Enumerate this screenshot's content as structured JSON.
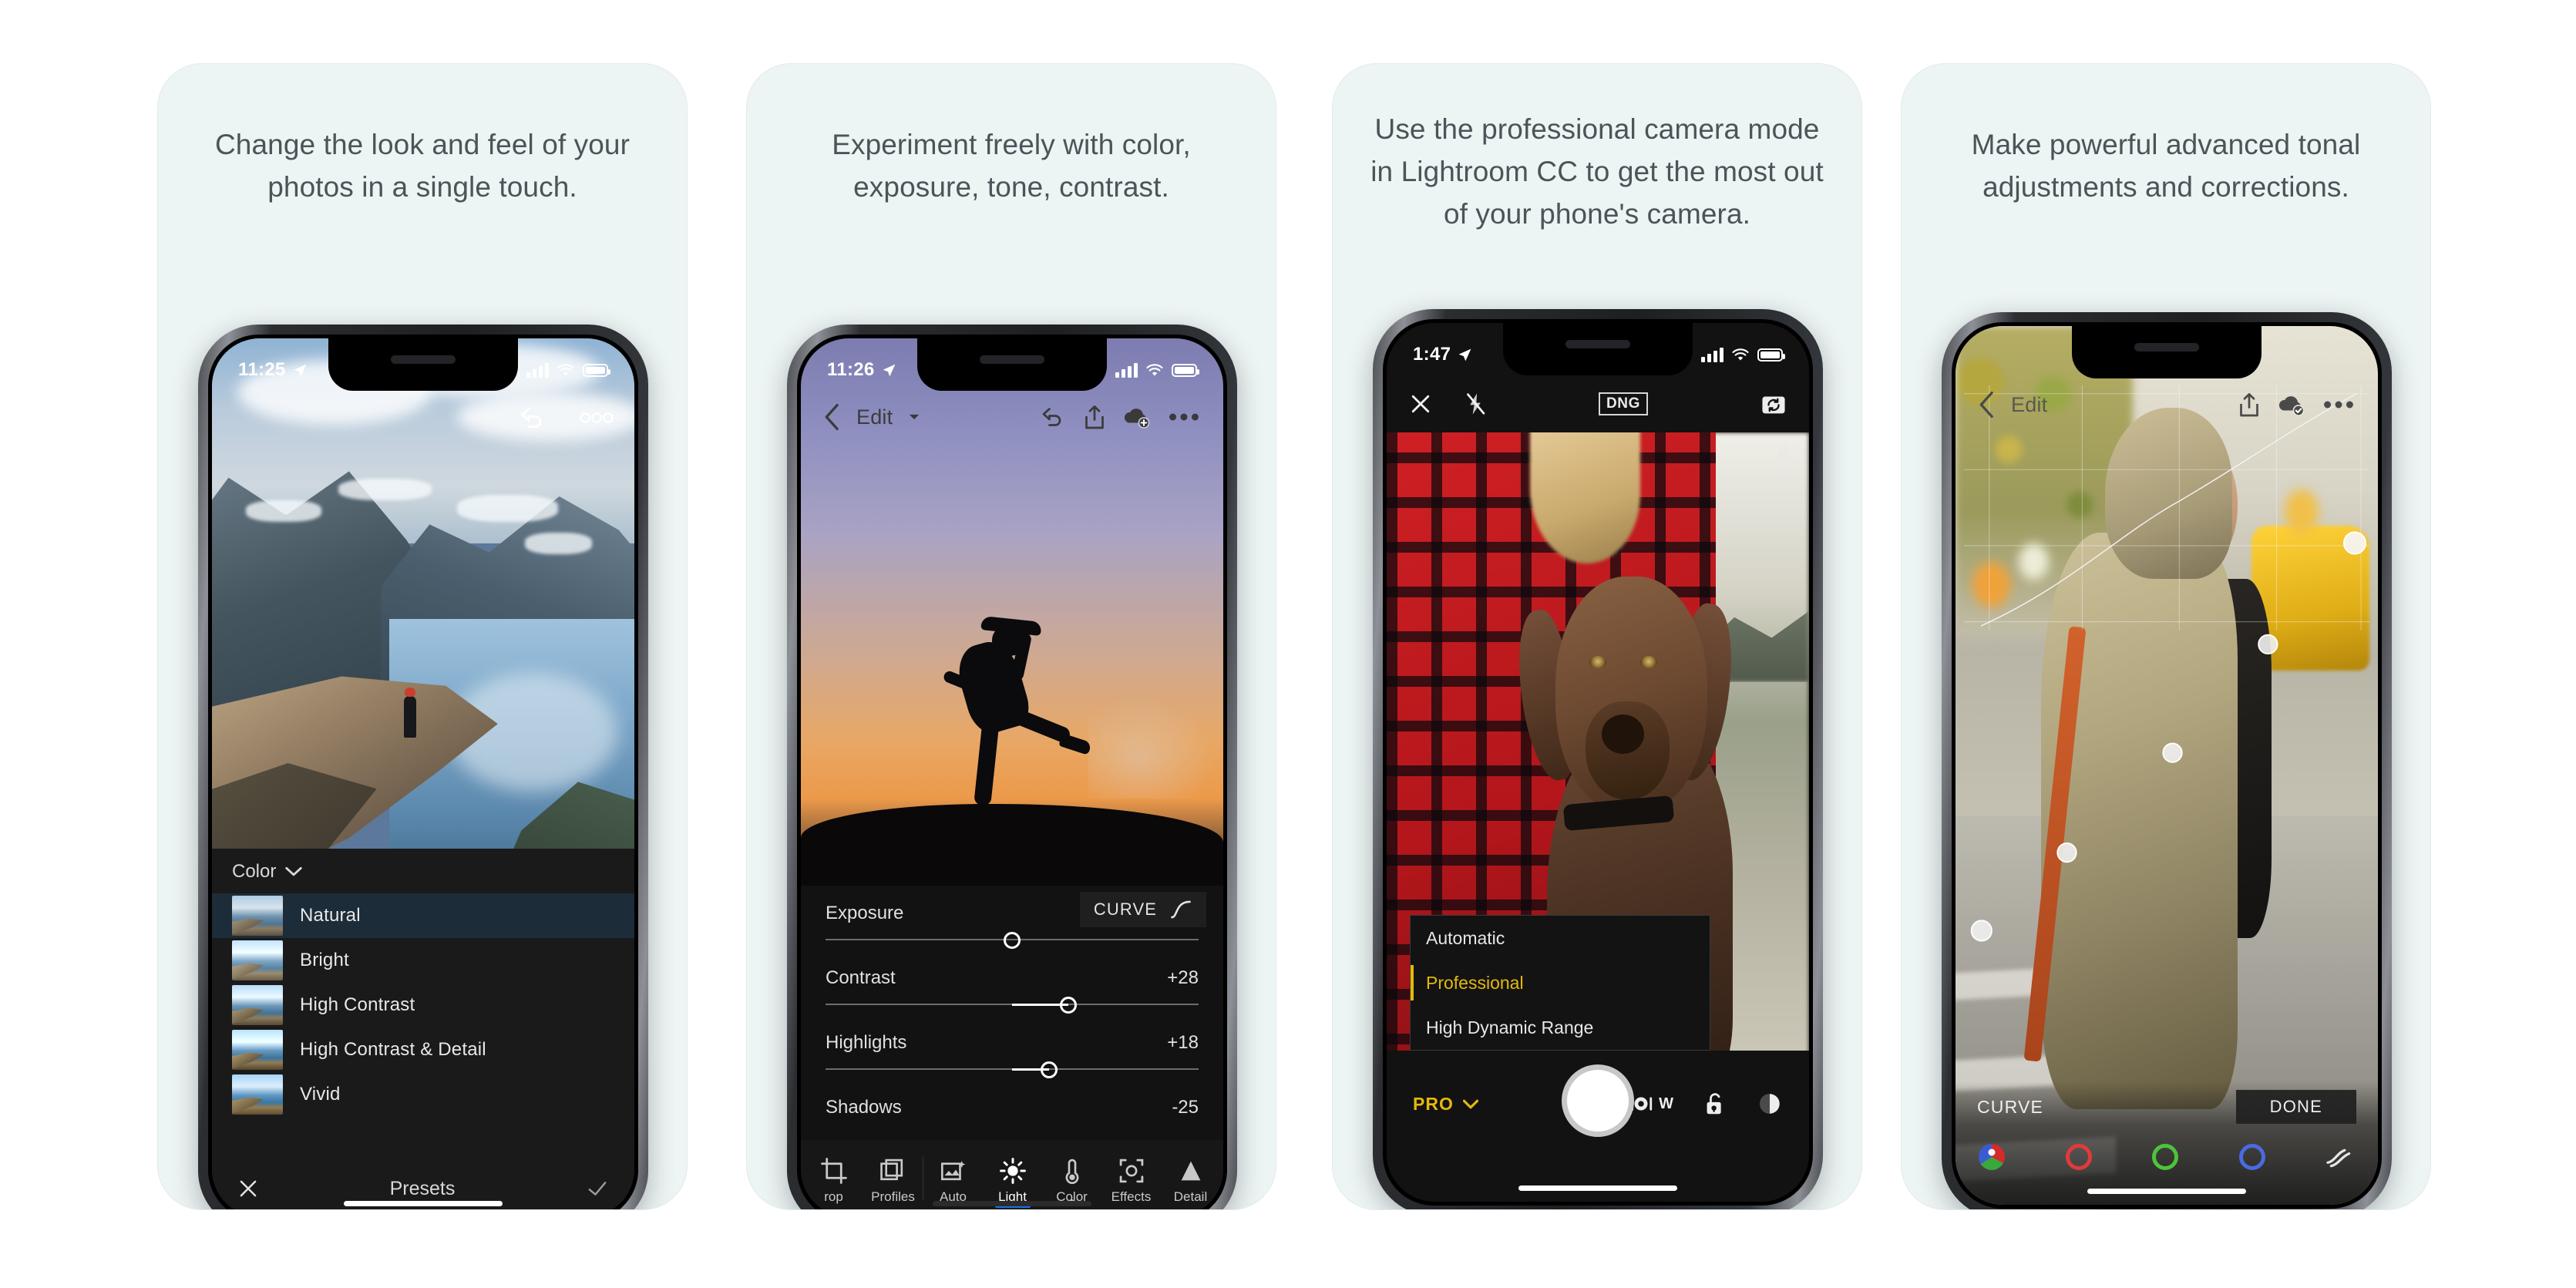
{
  "page": {
    "background": "#ffffff",
    "card_background": "#edf4f4"
  },
  "panels": [
    {
      "caption": "Change the look and feel of your photos in a single touch.",
      "status": {
        "time": "11:25",
        "location_icon": "location-arrow-icon"
      },
      "overlay_icons": [
        "undo-icon",
        "more-options-icon"
      ],
      "section": {
        "label": "Color",
        "chevron": "chevron-down-icon"
      },
      "presets": [
        {
          "label": "Natural",
          "selected": true
        },
        {
          "label": "Bright",
          "selected": false
        },
        {
          "label": "High Contrast",
          "selected": false
        },
        {
          "label": "High Contrast & Detail",
          "selected": false
        },
        {
          "label": "Vivid",
          "selected": false
        }
      ],
      "footer": {
        "close": "close-icon",
        "title": "Presets",
        "confirm": "check-icon"
      }
    },
    {
      "caption": "Experiment freely with color, exposure, tone, contrast.",
      "status": {
        "time": "11:26",
        "location_icon": "location-arrow-icon"
      },
      "nav": {
        "back": "back-chevron-icon",
        "title": "Edit",
        "caret": "caret-down-icon",
        "actions": [
          "undo-icon",
          "share-icon",
          "cloud-add-icon",
          "more-options-icon"
        ]
      },
      "curve_button": {
        "label": "CURVE",
        "icon": "curve-icon"
      },
      "sliders": [
        {
          "name": "Exposure",
          "value": "0.00",
          "pos": 50,
          "fill_from": 50
        },
        {
          "name": "Contrast",
          "value": "+28",
          "pos": 65,
          "fill_from": 50
        },
        {
          "name": "Highlights",
          "value": "+18",
          "pos": 60,
          "fill_from": 50
        },
        {
          "name": "Shadows",
          "value": "-25",
          "pos": 37,
          "fill_from": 50
        }
      ],
      "toolbar": [
        {
          "label": "rop",
          "icon": "crop-icon",
          "active": false
        },
        {
          "label": "Profiles",
          "icon": "profiles-icon",
          "active": false
        },
        {
          "label": "Auto",
          "icon": "auto-icon",
          "active": false
        },
        {
          "label": "Light",
          "icon": "light-icon",
          "active": true
        },
        {
          "label": "Color",
          "icon": "color-icon",
          "active": false,
          "dot": true
        },
        {
          "label": "Effects",
          "icon": "effects-icon",
          "active": false
        },
        {
          "label": "Detail",
          "icon": "detail-icon",
          "active": false
        }
      ]
    },
    {
      "caption": "Use the professional camera mode in Lightroom CC to get the most out of your phone's camera.",
      "status": {
        "time": "1:47",
        "location_icon": "location-arrow-icon"
      },
      "camera_top": {
        "close": "close-icon",
        "flash": "flash-off-icon",
        "format": "DNG",
        "flip": "camera-flip-icon"
      },
      "mode_menu": [
        {
          "label": "Automatic",
          "selected": false
        },
        {
          "label": "Professional",
          "selected": true
        },
        {
          "label": "High Dynamic Range",
          "selected": false
        }
      ],
      "controls": {
        "mode_label": "PRO",
        "mode_caret": "caret-down-icon",
        "shutter": "shutter-button",
        "lens_label": "W",
        "lens_icon": "lens-icon",
        "lock_icon": "lock-open-icon",
        "preview_icon": "preview-thumbnail-icon"
      }
    },
    {
      "caption": "Make powerful advanced tonal adjustments and corrections.",
      "nav": {
        "back": "back-chevron-icon",
        "title": "Edit",
        "actions": [
          "share-icon",
          "cloud-synced-icon",
          "more-options-icon"
        ]
      },
      "curve": {
        "label": "CURVE",
        "done_label": "DONE",
        "channels": [
          "rgb-wheel-icon",
          "red-channel-icon",
          "green-channel-icon",
          "blue-channel-icon"
        ],
        "extra_icon": "targeted-adjust-icon",
        "points": [
          [
            0,
            0
          ],
          [
            25,
            25
          ],
          [
            50,
            50
          ],
          [
            75,
            76
          ],
          [
            100,
            100
          ]
        ]
      }
    }
  ]
}
